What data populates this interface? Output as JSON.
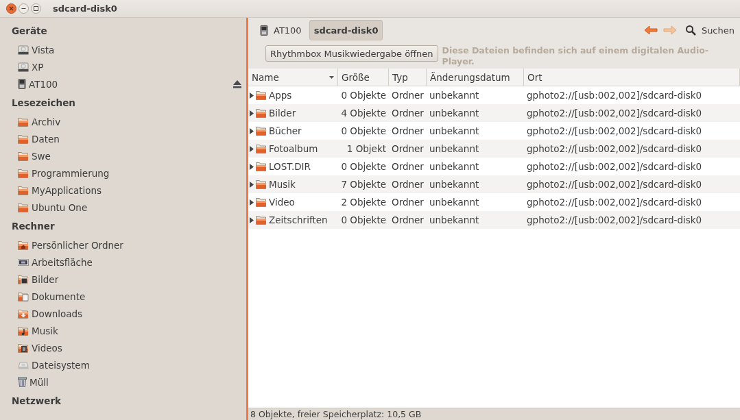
{
  "window": {
    "title": "sdcard-disk0"
  },
  "sidebar": {
    "sections": [
      {
        "title": "Geräte",
        "items": [
          {
            "label": "Vista",
            "kind": "drive",
            "ejectable": false
          },
          {
            "label": "XP",
            "kind": "drive",
            "ejectable": false
          },
          {
            "label": "AT100",
            "kind": "device",
            "ejectable": true
          }
        ]
      },
      {
        "title": "Lesezeichen",
        "items": [
          {
            "label": "Archiv",
            "kind": "folder",
            "ejectable": false
          },
          {
            "label": "Daten",
            "kind": "folder",
            "ejectable": false
          },
          {
            "label": "Swe",
            "kind": "folder",
            "ejectable": false
          },
          {
            "label": "Programmierung",
            "kind": "folder",
            "ejectable": false
          },
          {
            "label": "MyApplications",
            "kind": "folder",
            "ejectable": false
          },
          {
            "label": "Ubuntu One",
            "kind": "folder",
            "ejectable": false
          }
        ]
      },
      {
        "title": "Rechner",
        "items": [
          {
            "label": "Persönlicher Ordner",
            "kind": "home",
            "ejectable": false
          },
          {
            "label": "Arbeitsfläche",
            "kind": "desktop",
            "ejectable": false
          },
          {
            "label": "Bilder",
            "kind": "pictures",
            "ejectable": false
          },
          {
            "label": "Dokumente",
            "kind": "documents",
            "ejectable": false
          },
          {
            "label": "Downloads",
            "kind": "downloads",
            "ejectable": false
          },
          {
            "label": "Musik",
            "kind": "music",
            "ejectable": false
          },
          {
            "label": "Videos",
            "kind": "videos",
            "ejectable": false
          },
          {
            "label": "Dateisystem",
            "kind": "filesystem",
            "ejectable": false
          },
          {
            "label": "Müll",
            "kind": "trash",
            "ejectable": false
          }
        ]
      },
      {
        "title": "Netzwerk"
      }
    ]
  },
  "path_bar": [
    {
      "label": "AT100",
      "kind": "device",
      "selected": false
    },
    {
      "label": "sdcard-disk0",
      "kind": "none",
      "selected": true
    }
  ],
  "toolbar": {
    "search_label": "Suchen"
  },
  "info_bar": {
    "button": "Rhythmbox Musikwiedergabe öffnen",
    "message": "Diese Dateien befinden sich auf einem digitalen Audio-Player."
  },
  "table": {
    "columns": [
      {
        "label": "Name",
        "sorted": true
      },
      {
        "label": "Größe",
        "sorted": false
      },
      {
        "label": "Typ",
        "sorted": false
      },
      {
        "label": "Änderungsdatum",
        "sorted": false
      },
      {
        "label": "Ort",
        "sorted": false
      }
    ],
    "rows": [
      {
        "name": "Apps",
        "size": "0 Objekte",
        "type": "Ordner",
        "modified": "unbekannt",
        "location": "gphoto2://[usb:002,002]/sdcard-disk0"
      },
      {
        "name": "Bilder",
        "size": "4 Objekte",
        "type": "Ordner",
        "modified": "unbekannt",
        "location": "gphoto2://[usb:002,002]/sdcard-disk0"
      },
      {
        "name": "Bücher",
        "size": "0 Objekte",
        "type": "Ordner",
        "modified": "unbekannt",
        "location": "gphoto2://[usb:002,002]/sdcard-disk0"
      },
      {
        "name": "Fotoalbum",
        "size": "1 Objekt",
        "type": "Ordner",
        "modified": "unbekannt",
        "location": "gphoto2://[usb:002,002]/sdcard-disk0"
      },
      {
        "name": "LOST.DIR",
        "size": "0 Objekte",
        "type": "Ordner",
        "modified": "unbekannt",
        "location": "gphoto2://[usb:002,002]/sdcard-disk0"
      },
      {
        "name": "Musik",
        "size": "7 Objekte",
        "type": "Ordner",
        "modified": "unbekannt",
        "location": "gphoto2://[usb:002,002]/sdcard-disk0"
      },
      {
        "name": "Video",
        "size": "2 Objekte",
        "type": "Ordner",
        "modified": "unbekannt",
        "location": "gphoto2://[usb:002,002]/sdcard-disk0"
      },
      {
        "name": "Zeitschriften",
        "size": "0 Objekte",
        "type": "Ordner",
        "modified": "unbekannt",
        "location": "gphoto2://[usb:002,002]/sdcard-disk0"
      }
    ]
  },
  "status_bar": "8 Objekte, freier Speicherplatz: 10,5 GB"
}
